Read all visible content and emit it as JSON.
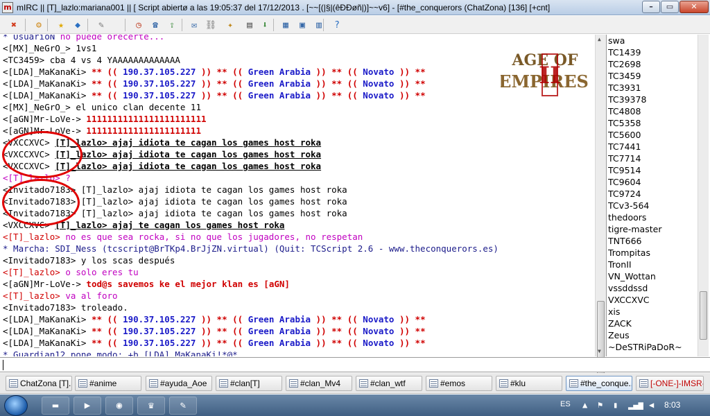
{
  "window": {
    "title": "mIRC || [T]_lazlo:mariana001 || [ Script abiertø a las 19:05:37 del 17/12/2013 . [~~[(|§|(êÐÐøñ|)]~~v6] - [#the_conquerors (ChatZona) [136] [+cnt]",
    "minimize": "0",
    "maximize": "1",
    "close": "r"
  },
  "toolbar_icons": [
    "connect-icon",
    "options-icon",
    "favorites-icon",
    "channels-icon",
    "scripts-editor-icon",
    "timer-icon",
    "address-book-icon",
    "dcc-send-icon",
    "dcc-chat-icon",
    "url-list-icon",
    "notify-icon",
    "log-icon",
    "received-files-icon",
    "tile-icon",
    "cascade-icon",
    "arrange-icon",
    "help-icon"
  ],
  "chat_lines": [
    {
      "segs": [
        {
          "t": "* UsuarioN ",
          "c": "navy"
        },
        {
          "t": "no puede orecerte...",
          "c": "magenta"
        }
      ]
    },
    {
      "segs": [
        {
          "t": "<[MX]_NeGrO_> 1vs1"
        }
      ]
    },
    {
      "segs": [
        {
          "t": "<TC3459> cba 4 vs 4 YAAAAAAAAAAAAA"
        }
      ]
    },
    {
      "segs": [
        {
          "t": "<[LDA]_MaKanaKi> "
        },
        {
          "t": "** (( ",
          "c": "red",
          "b": true
        },
        {
          "t": "190.37.105.227",
          "c": "blue",
          "b": true
        },
        {
          "t": " )) ** (( ",
          "c": "red",
          "b": true
        },
        {
          "t": "Green Arabia",
          "c": "blue",
          "b": true
        },
        {
          "t": " )) ** (( ",
          "c": "red",
          "b": true
        },
        {
          "t": "Novato",
          "c": "blue",
          "b": true
        },
        {
          "t": " )) **",
          "c": "red",
          "b": true
        }
      ]
    },
    {
      "segs": [
        {
          "t": "<[LDA]_MaKanaKi> "
        },
        {
          "t": "** (( ",
          "c": "red",
          "b": true
        },
        {
          "t": "190.37.105.227",
          "c": "blue",
          "b": true
        },
        {
          "t": " )) ** (( ",
          "c": "red",
          "b": true
        },
        {
          "t": "Green Arabia",
          "c": "blue",
          "b": true
        },
        {
          "t": " )) ** (( ",
          "c": "red",
          "b": true
        },
        {
          "t": "Novato",
          "c": "blue",
          "b": true
        },
        {
          "t": " )) **",
          "c": "red",
          "b": true
        }
      ]
    },
    {
      "segs": [
        {
          "t": "<[LDA]_MaKanaKi> "
        },
        {
          "t": "** (( ",
          "c": "red",
          "b": true
        },
        {
          "t": "190.37.105.227",
          "c": "blue",
          "b": true
        },
        {
          "t": " )) ** (( ",
          "c": "red",
          "b": true
        },
        {
          "t": "Green Arabia",
          "c": "blue",
          "b": true
        },
        {
          "t": " )) ** (( ",
          "c": "red",
          "b": true
        },
        {
          "t": "Novato",
          "c": "blue",
          "b": true
        },
        {
          "t": " )) **",
          "c": "red",
          "b": true
        }
      ]
    },
    {
      "segs": [
        {
          "t": "<[MX]_NeGrO_> el unico clan decente 11"
        }
      ]
    },
    {
      "segs": [
        {
          "t": "<[aGN]Mr-LoVe-> "
        },
        {
          "t": "11111111111111111111111",
          "c": "red",
          "b": true
        }
      ]
    },
    {
      "segs": [
        {
          "t": "<[aGN]Mr-LoVe-> "
        },
        {
          "t": "1111111111111111111111",
          "c": "red",
          "b": true
        }
      ]
    },
    {
      "segs": [
        {
          "t": "<VXCCXVC> "
        },
        {
          "t": "[T]_lazlo> ajaj idiota te cagan los games host roka",
          "b": true,
          "u": true
        }
      ]
    },
    {
      "segs": [
        {
          "t": "<VXCCXVC> "
        },
        {
          "t": "[T]_lazlo> ajaj idiota te cagan los games host roka",
          "b": true,
          "u": true
        }
      ]
    },
    {
      "segs": [
        {
          "t": "<VXCCXVC> "
        },
        {
          "t": "[T]_lazlo> ajaj idiota te cagan los games host roka",
          "b": true,
          "u": true
        }
      ]
    },
    {
      "segs": [
        {
          "t": "<[T]_lazlo> ?",
          "c": "magenta"
        }
      ]
    },
    {
      "segs": [
        {
          "t": "<Invitado7183> [T]_lazlo> ajaj idiota te cagan los games host roka"
        }
      ]
    },
    {
      "segs": [
        {
          "t": "<Invitado7183> [T]_lazlo> ajaj idiota te cagan los games host roka"
        }
      ]
    },
    {
      "segs": [
        {
          "t": "<Invitado7183> [T]_lazlo> ajaj idiota te cagan los games host roka"
        }
      ]
    },
    {
      "segs": [
        {
          "t": "<VXCCXVC> "
        },
        {
          "t": "[T]_lazlo> ajaj te cagan los games host roka",
          "b": true,
          "u": true
        }
      ]
    },
    {
      "segs": [
        {
          "t": "<[T]_lazlo> ",
          "c": "red"
        },
        {
          "t": "no es que sea rocka, si no que los jugadores, no respetan",
          "c": "magenta"
        }
      ]
    },
    {
      "segs": [
        {
          "t": "* Marcha: SDI_Ness (tcscript@BrTKp4.BrJjZN.virtual) (Quit: TCScript 2.6 - www.theconquerors.es)",
          "c": "navy"
        }
      ]
    },
    {
      "segs": [
        {
          "t": "<Invitado7183> y los scas después"
        }
      ]
    },
    {
      "segs": [
        {
          "t": "<[T]_lazlo> ",
          "c": "red"
        },
        {
          "t": "o solo eres tu",
          "c": "magenta"
        }
      ]
    },
    {
      "segs": [
        {
          "t": "<[aGN]Mr-LoVe-> "
        },
        {
          "t": "tod@s savemos ke el mejor klan es [aGN]",
          "c": "red",
          "b": true
        }
      ]
    },
    {
      "segs": [
        {
          "t": "<[T]_lazlo> ",
          "c": "red"
        },
        {
          "t": "va al foro",
          "c": "magenta"
        }
      ]
    },
    {
      "segs": [
        {
          "t": "<Invitado7183> troleado."
        }
      ]
    },
    {
      "segs": [
        {
          "t": "<[LDA]_MaKanaKi> "
        },
        {
          "t": "** (( ",
          "c": "red",
          "b": true
        },
        {
          "t": "190.37.105.227",
          "c": "blue",
          "b": true
        },
        {
          "t": " )) ** (( ",
          "c": "red",
          "b": true
        },
        {
          "t": "Green Arabia",
          "c": "blue",
          "b": true
        },
        {
          "t": " )) ** (( ",
          "c": "red",
          "b": true
        },
        {
          "t": "Novato",
          "c": "blue",
          "b": true
        },
        {
          "t": " )) **",
          "c": "red",
          "b": true
        }
      ]
    },
    {
      "segs": [
        {
          "t": "<[LDA]_MaKanaKi> "
        },
        {
          "t": "** (( ",
          "c": "red",
          "b": true
        },
        {
          "t": "190.37.105.227",
          "c": "blue",
          "b": true
        },
        {
          "t": " )) ** (( ",
          "c": "red",
          "b": true
        },
        {
          "t": "Green Arabia",
          "c": "blue",
          "b": true
        },
        {
          "t": " )) ** (( ",
          "c": "red",
          "b": true
        },
        {
          "t": "Novato",
          "c": "blue",
          "b": true
        },
        {
          "t": " )) **",
          "c": "red",
          "b": true
        }
      ]
    },
    {
      "segs": [
        {
          "t": "<[LDA]_MaKanaKi> "
        },
        {
          "t": "** (( ",
          "c": "red",
          "b": true
        },
        {
          "t": "190.37.105.227",
          "c": "blue",
          "b": true
        },
        {
          "t": " )) ** (( ",
          "c": "red",
          "b": true
        },
        {
          "t": "Green Arabia",
          "c": "blue",
          "b": true
        },
        {
          "t": " )) ** (( ",
          "c": "red",
          "b": true
        },
        {
          "t": "Novato",
          "c": "blue",
          "b": true
        },
        {
          "t": " )) **",
          "c": "red",
          "b": true
        }
      ]
    },
    {
      "segs": [
        {
          "t": "* Guardian12 pone modo: +b [LDA]_MaKanaKi!*@*",
          "c": "navy"
        }
      ]
    }
  ],
  "logo": {
    "line1": "AGE OF",
    "line2": "EMPIRES",
    "numeral": "II"
  },
  "nicklist": [
    "swa",
    "TC1439",
    "TC2698",
    "TC3459",
    "TC3931",
    "TC39378",
    "TC4808",
    "TC5358",
    "TC5600",
    "TC7441",
    "TC7714",
    "TC9514",
    "TC9604",
    "TC9724",
    "TCv3-564",
    "thedoors",
    "tigre-master",
    "TNT666",
    "Trompitas",
    "TronII",
    "VN_Wottan",
    "vssddssd",
    "VXCCXVC",
    "xis",
    "ZACK",
    "Zeus",
    "~DeSTRiPaDoR~"
  ],
  "input": {
    "value": ""
  },
  "switchbar": [
    {
      "label": "ChatZona [T]...",
      "state": "normal"
    },
    {
      "label": "#anime",
      "state": "normal"
    },
    {
      "label": "#ayuda_Aoe",
      "state": "normal"
    },
    {
      "label": "#clan[T]",
      "state": "normal"
    },
    {
      "label": "#clan_Mv4",
      "state": "normal"
    },
    {
      "label": "#clan_wtf",
      "state": "normal"
    },
    {
      "label": "#emos",
      "state": "normal"
    },
    {
      "label": "#klu",
      "state": "normal"
    },
    {
      "label": "#the_conque...",
      "state": "active"
    },
    {
      "label": "[-ONE-]-IMSR-...",
      "state": "alert"
    }
  ],
  "taskbar": {
    "pinned": [
      "explorer-icon",
      "media-player-icon",
      "chrome-icon",
      "mirc-icon",
      "paint-icon"
    ],
    "language": "ES",
    "clock": "8:03"
  },
  "colors": {
    "red": "#d00000",
    "blue": "#1a1ac8",
    "magenta": "#c000c0",
    "navy": "#1b1b8a",
    "circle": "#e00000"
  }
}
